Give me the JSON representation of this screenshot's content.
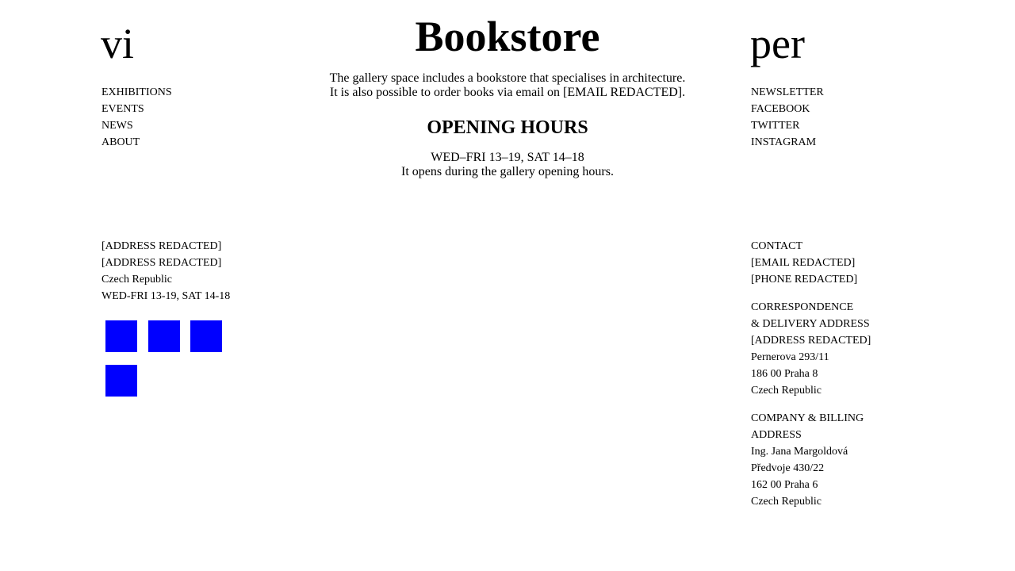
{
  "logo": {
    "left": "vi",
    "right": "per"
  },
  "nav_left": [
    {
      "label": "EXHIBITIONS"
    },
    {
      "label": "EVENTS"
    },
    {
      "label": "NEWS"
    },
    {
      "label": "ABOUT"
    }
  ],
  "nav_right": [
    {
      "label": "NEWSLETTER"
    },
    {
      "label": "FACEBOOK"
    },
    {
      "label": "TWITTER"
    },
    {
      "label": "INSTAGRAM"
    }
  ],
  "main": {
    "title": "Bookstore",
    "intro_line1": "The gallery space includes a bookstore that specialises in architecture.",
    "intro_line2": "It is also possible to order books via email on [EMAIL REDACTED].",
    "hours_heading": "OPENING HOURS",
    "hours_line1": "WED–FRI 13–19, SAT 14–18",
    "hours_line2": "It opens during the gallery opening hours."
  },
  "footer_left": {
    "address1": "[ADDRESS REDACTED]",
    "address2": "[ADDRESS REDACTED]",
    "country": "Czech Republic",
    "hours": "WED-FRI 13-19, SAT 14-18"
  },
  "social_icons": [
    {
      "icon": "social-icon-1",
      "color": "#0000ff"
    },
    {
      "icon": "social-icon-2",
      "color": "#0000ff"
    },
    {
      "icon": "social-icon-3",
      "color": "#0000ff"
    },
    {
      "icon": "social-icon-4",
      "color": "#0000ff"
    }
  ],
  "footer_right": {
    "contact": {
      "heading": "CONTACT",
      "email": "[EMAIL REDACTED]",
      "phone": "[PHONE REDACTED]"
    },
    "correspondence": {
      "heading1": "CORRESPONDENCE",
      "heading2": "& DELIVERY ADDRESS",
      "line1": "[ADDRESS REDACTED]",
      "line2": "Pernerova 293/11",
      "line3": "186 00 Praha 8",
      "line4": "Czech Republic"
    },
    "company": {
      "heading1": "COMPANY & BILLING",
      "heading2": "ADDRESS",
      "line1": "Ing. Jana Margoldová",
      "line2": "Předvoje 430/22",
      "line3": "162 00 Praha 6",
      "line4": "Czech Republic"
    }
  }
}
